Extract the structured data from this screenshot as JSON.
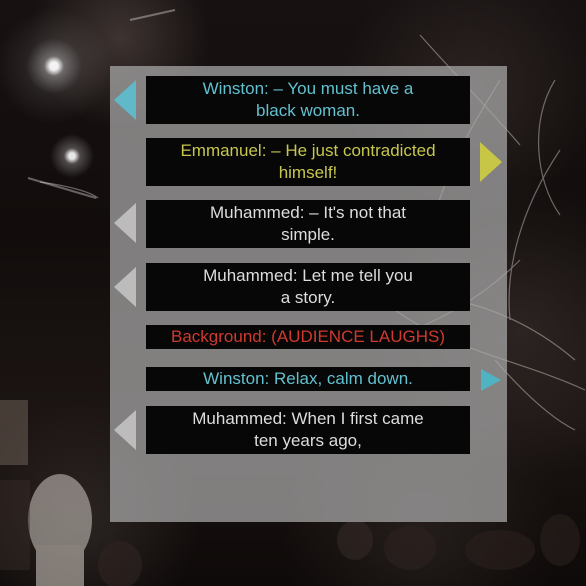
{
  "colors": {
    "winston": "#62c0cf",
    "emmanuel": "#c7c64f",
    "muhammed": "#dddddd",
    "background": "#d0392f",
    "left_arrow_inactive": "#bcbcbc",
    "left_arrow_active": "#60b8c9",
    "right_arrow_active": "#c8c646",
    "small_arrow_active": "#4fb3c3"
  },
  "subtitles": [
    {
      "speaker": "Winston",
      "text": "Winston: – You must have a black woman.",
      "line1": "Winston: – You must have a",
      "line2": "black woman.",
      "color_key": "winston",
      "arrow": "left"
    },
    {
      "speaker": "Emmanuel",
      "text": "Emmanuel: – He just contradicted himself!",
      "line1": "Emmanuel: – He just contradicted",
      "line2": "himself!",
      "color_key": "emmanuel",
      "arrow": "right"
    },
    {
      "speaker": "Muhammed",
      "text": "Muhammed: – It's not that simple.",
      "line1": "Muhammed: – It's not that",
      "line2": "simple.",
      "color_key": "muhammed",
      "arrow": "left"
    },
    {
      "speaker": "Muhammed",
      "text": "Muhammed: Let me tell you a story.",
      "line1": "Muhammed: Let me tell you",
      "line2": "a story.",
      "color_key": "muhammed",
      "arrow": "left"
    },
    {
      "speaker": "Background",
      "text": "Background: (AUDIENCE LAUGHS)",
      "line1": "Background: (AUDIENCE LAUGHS)",
      "line2": "",
      "color_key": "background",
      "arrow": "none"
    },
    {
      "speaker": "Winston",
      "text": "Winston: Relax, calm down.",
      "line1": "Winston: Relax, calm down.",
      "line2": "",
      "color_key": "winston",
      "arrow": "small-right"
    },
    {
      "speaker": "Muhammed",
      "text": "Muhammed: When I first came ten years ago,",
      "line1": "Muhammed: When I first came",
      "line2": "ten years ago,",
      "color_key": "muhammed",
      "arrow": "left"
    }
  ]
}
